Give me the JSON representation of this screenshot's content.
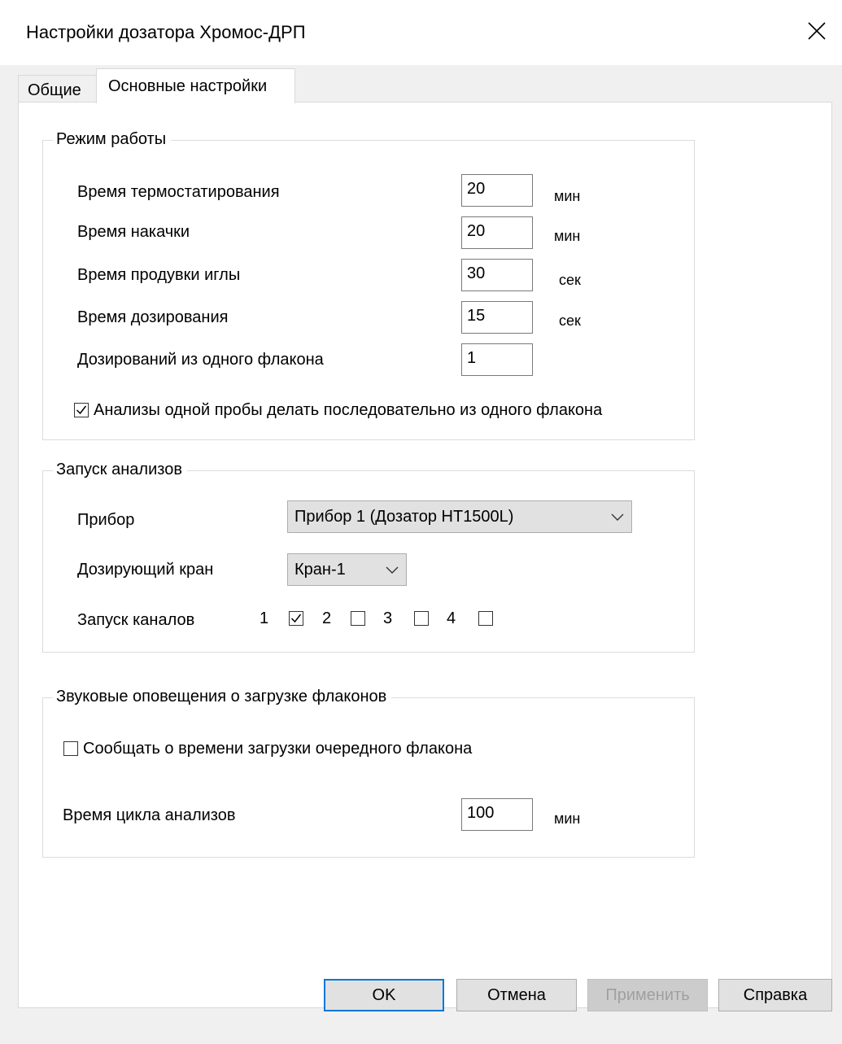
{
  "window": {
    "title": "Настройки дозатора Хромос-ДРП",
    "close_icon": "close-icon"
  },
  "tabs": [
    {
      "label": "Общие",
      "active": false
    },
    {
      "label": "Основные настройки",
      "active": true
    }
  ],
  "mode": {
    "title": "Режим работы",
    "rows": [
      {
        "label": "Время термостатирования",
        "value": "20",
        "unit": "мин"
      },
      {
        "label": "Время накачки",
        "value": "20",
        "unit": "мин"
      },
      {
        "label": "Время продувки иглы",
        "value": "30",
        "unit": "сек"
      },
      {
        "label": "Время дозирования",
        "value": "15",
        "unit": "сек"
      },
      {
        "label": "Дозирований из одного флакона",
        "value": "1",
        "unit": ""
      }
    ],
    "sequential_checkbox": {
      "label": "Анализы одной пробы делать последовательно из одного флакона",
      "checked": true
    }
  },
  "launch": {
    "title": "Запуск анализов",
    "device_label": "Прибор",
    "device_value": "Прибор 1 (Дозатор НТ1500L)",
    "valve_label": "Дозирующий кран",
    "valve_value": "Кран-1",
    "channels_label": "Запуск каналов",
    "channels": [
      {
        "label": "1",
        "checked": true
      },
      {
        "label": "2",
        "checked": false
      },
      {
        "label": "3",
        "checked": false
      },
      {
        "label": "4",
        "checked": false
      }
    ]
  },
  "sound": {
    "title": "Звуковые оповещения о загрузке флаконов",
    "notify_checkbox": {
      "label": "Сообщать о времени загрузки очередного флакона",
      "checked": false
    },
    "cycle_label": "Время цикла анализов",
    "cycle_value": "100",
    "cycle_unit": "мин"
  },
  "buttons": {
    "ok": "OK",
    "cancel": "Отмена",
    "apply": "Применить",
    "help": "Справка"
  }
}
